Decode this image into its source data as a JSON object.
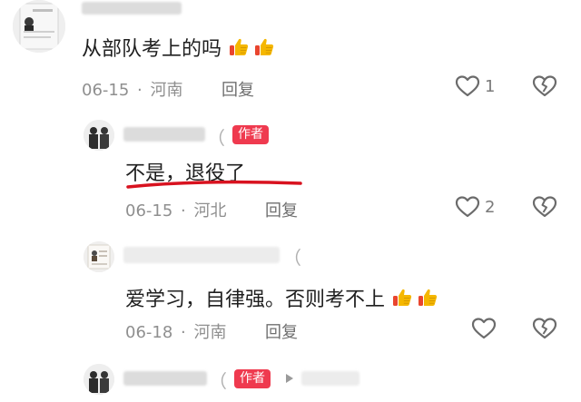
{
  "comments": [
    {
      "text": "从部队考上的吗",
      "date": "06-15",
      "sep": "·",
      "location": "河南",
      "reply": "回复",
      "likes": "1"
    },
    {
      "author_tag": "作者",
      "paren": "（",
      "text": "不是，退役了",
      "date": "06-15",
      "sep": "·",
      "location": "河北",
      "reply": "回复",
      "likes": "2"
    },
    {
      "paren": "（",
      "text": "爱学习，自律强。否则考不上",
      "date": "06-18",
      "sep": "·",
      "location": "河南",
      "reply": "回复"
    },
    {
      "author_tag": "作者",
      "paren": "（"
    }
  ],
  "colors": {
    "author_tag": "#ef3a4f",
    "underline": "#d8121f",
    "thumb_emoji": "#f5b700"
  },
  "icons": [
    "heart-icon",
    "broken-heart-icon",
    "thumbs-up-emoji"
  ]
}
